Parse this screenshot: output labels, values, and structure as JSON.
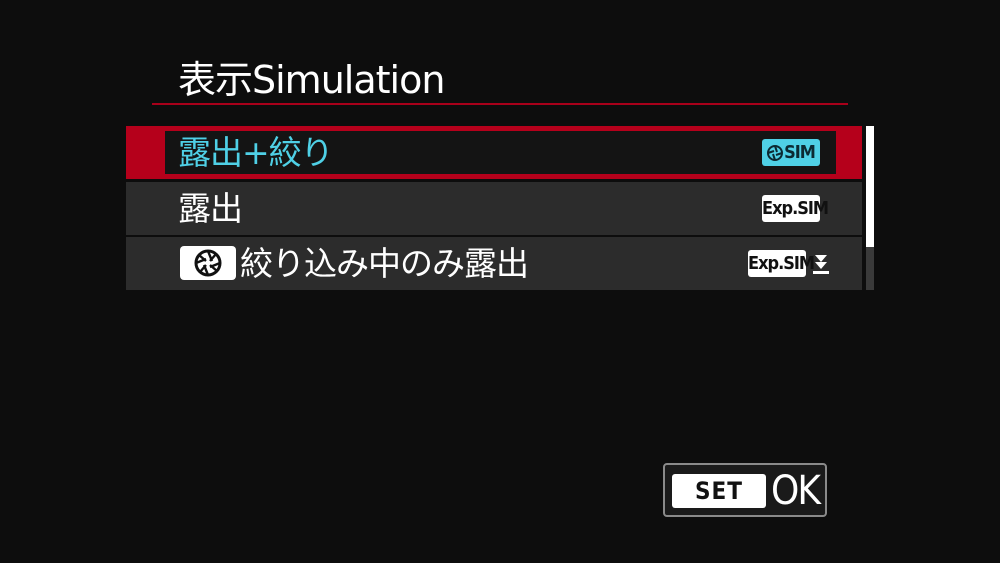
{
  "header": {
    "title": "表示Simulation"
  },
  "menu": {
    "items": [
      {
        "label": "露出+絞り",
        "badge": "SIM",
        "icon": "aperture-icon",
        "selected": true
      },
      {
        "label": "露出",
        "badge": "Exp.SIM",
        "selected": false
      },
      {
        "label": "絞り込み中のみ露出",
        "badge": "Exp.SIM",
        "lead_icon": "aperture-icon",
        "trail_icon": "download-arrow-icon",
        "selected": false
      }
    ]
  },
  "footer": {
    "set_key": "SET",
    "ok_label": "OK"
  },
  "colors": {
    "background": "#0d0d0d",
    "accent_red": "#b5001b",
    "title_rule": "#a8001a",
    "selected_text": "#4fd0e6",
    "row_background": "#2c2c2c"
  },
  "scroll": {
    "visible_fraction": 0.74
  }
}
